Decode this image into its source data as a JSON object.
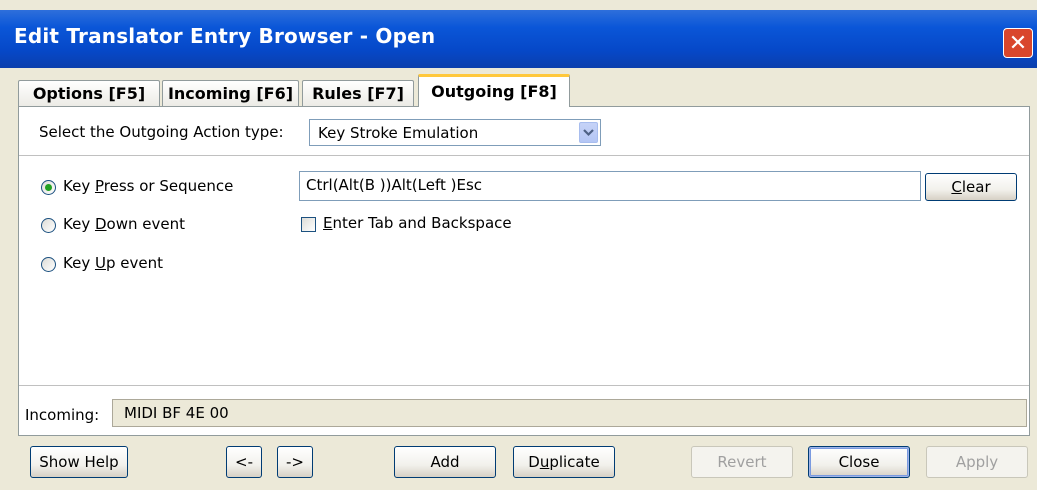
{
  "window": {
    "title": "Edit Translator Entry Browser - Open",
    "close_glyph": "✕"
  },
  "tabs": [
    {
      "label": "Options [F5]",
      "active": false
    },
    {
      "label": "Incoming [F6]",
      "active": false
    },
    {
      "label": "Rules [F7]",
      "active": false
    },
    {
      "label": "Outgoing [F8]",
      "active": true
    }
  ],
  "action_type": {
    "label": "Select the Outgoing Action type:",
    "selected": "Key Stroke Emulation"
  },
  "radios": [
    {
      "label_pre": "Key ",
      "mnemonic": "P",
      "label_post": "ress or Sequence",
      "checked": true
    },
    {
      "label_pre": "Key ",
      "mnemonic": "D",
      "label_post": "own event",
      "checked": false
    },
    {
      "label_pre": "Key ",
      "mnemonic": "U",
      "label_post": "p event",
      "checked": false
    }
  ],
  "sequence": {
    "value": "Ctrl(Alt(B ))Alt(Left )Esc",
    "clear_mnemonic": "C",
    "clear_rest": "lear"
  },
  "checkbox": {
    "mnemonic": "E",
    "label_rest": "nter Tab and Backspace",
    "checked": false
  },
  "incoming": {
    "label": "Incoming:",
    "value": "MIDI BF 4E 00"
  },
  "buttons": {
    "show_help": "Show Help",
    "prev": "<-",
    "next": "->",
    "add": "Add",
    "duplicate_pre": "D",
    "duplicate_mnemonic": "u",
    "duplicate_post": "plicate",
    "revert": "Revert",
    "close": "Close",
    "apply": "Apply"
  }
}
